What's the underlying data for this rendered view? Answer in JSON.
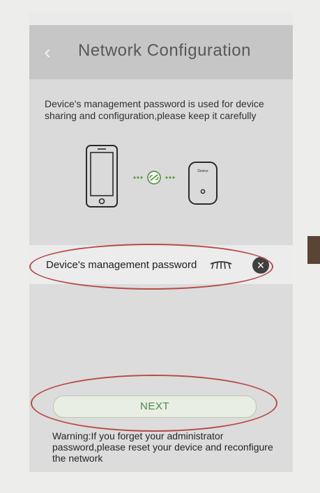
{
  "header": {
    "back_icon": "chevron-left-icon",
    "title": "Network Configuration"
  },
  "intro": {
    "description": "Device's management password is used for device sharing and configuration,please keep it carefully",
    "phone_icon": "phone-icon",
    "link_icon": "link-icon",
    "device_icon": "device-icon",
    "device_label": "Device"
  },
  "password": {
    "label": "Device's management password",
    "eye_icon": "eye-closed-icon",
    "clear_icon": "clear-icon",
    "clear_glyph": "×"
  },
  "actions": {
    "next_label": "NEXT"
  },
  "warning": {
    "text": "Warning:If you forget your administrator password,please reset your device and reconfigure the network"
  },
  "colors": {
    "header_bg": "#c6c6c6",
    "panel_bg": "#dadada",
    "next_text": "#4b8a43",
    "highlight": "#b74a4a"
  }
}
